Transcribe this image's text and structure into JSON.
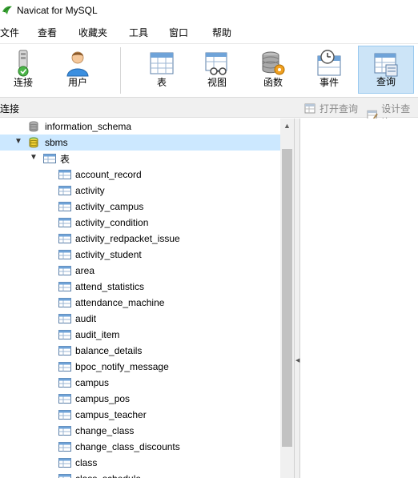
{
  "window": {
    "title": "Navicat for MySQL"
  },
  "menu": [
    "文件",
    "查看",
    "收藏夹",
    "工具",
    "窗口",
    "帮助"
  ],
  "toolbar": [
    {
      "label": "连接",
      "icon": "connection-icon"
    },
    {
      "label": "用户",
      "icon": "user-icon"
    },
    {
      "label": "表",
      "icon": "table-icon"
    },
    {
      "label": "视图",
      "icon": "view-icon"
    },
    {
      "label": "函数",
      "icon": "function-icon"
    },
    {
      "label": "事件",
      "icon": "event-icon"
    },
    {
      "label": "查询",
      "icon": "query-icon",
      "active": true
    }
  ],
  "panel": {
    "title": "连接",
    "open_query": "打开查询",
    "design_query": "设计查询"
  },
  "tree": {
    "databases": [
      {
        "name": "information_schema",
        "expanded": false
      },
      {
        "name": "sbms",
        "expanded": true,
        "selected": true
      }
    ],
    "tables_folder": "表",
    "tables": [
      "account_record",
      "activity",
      "activity_campus",
      "activity_condition",
      "activity_redpacket_issue",
      "activity_student",
      "area",
      "attend_statistics",
      "attendance_machine",
      "audit",
      "audit_item",
      "balance_details",
      "bpoc_notify_message",
      "campus",
      "campus_pos",
      "campus_teacher",
      "change_class",
      "change_class_discounts",
      "class",
      "class_schedule"
    ]
  },
  "colors": {
    "selected_row": "#cce8ff",
    "active_tool": "#cce4f7",
    "accent": "#1e90ff"
  }
}
